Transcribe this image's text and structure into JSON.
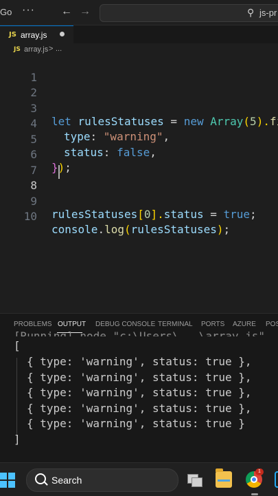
{
  "titlebar": {
    "menu_go": "Go",
    "more": "···",
    "back": "←",
    "forward": "→",
    "search_text": "js-pr"
  },
  "tab": {
    "badge": "JS",
    "label": "array.js"
  },
  "breadcrumb": {
    "badge": "JS",
    "file": "array.js",
    "separator": ">",
    "more": "..."
  },
  "editor": {
    "line_numbers": [
      "1",
      "2",
      "3",
      "4",
      "5",
      "6",
      "7",
      "8",
      "9",
      "10"
    ],
    "tokens": {
      "let": "let",
      "rules_statuses": "rulesStatuses",
      "eq": " = ",
      "new": "new",
      "array": "Array",
      "paren_open": "(",
      "five": "5",
      "paren_close_dot": ").",
      "fill": "fil",
      "type_key": "type",
      "colon": ": ",
      "warning_str": "\"warning\"",
      "comma": ",",
      "status_key": "status",
      "false": "false",
      "close_brace": "}",
      "close_paren": ")",
      "semicolon": ";",
      "index_open": "[",
      "zero": "0",
      "index_close_dot": "].",
      "status_prop": "status",
      "true": "true",
      "console": "console",
      "dot": ".",
      "log": "log",
      "rules_statuses_arg": "rulesStatuses",
      "close_call": ");"
    }
  },
  "panel": {
    "tabs": [
      "PROBLEMS",
      "OUTPUT",
      "DEBUG CONSOLE",
      "TERMINAL",
      "PORTS",
      "AZURE",
      "POS"
    ],
    "active_tab": "OUTPUT",
    "cut_line": "[Running] node \"c:\\Users\\...\\array.js\"",
    "open_bracket": "[",
    "entries": [
      "{ type: 'warning', status: true },",
      "{ type: 'warning', status: true },",
      "{ type: 'warning', status: true },",
      "{ type: 'warning', status: true },",
      "{ type: 'warning', status: true }"
    ],
    "close_bracket": "]"
  },
  "taskbar": {
    "search_label": "Search",
    "chrome_badge": "1"
  },
  "colors": {
    "keyword": "#569cd6",
    "variable": "#9cdcfe",
    "class": "#4ec9b0",
    "number": "#b5cea8",
    "string": "#ce9178",
    "function": "#dcdcaa",
    "accent": "#0078d4",
    "js_badge": "#e8d44d"
  }
}
